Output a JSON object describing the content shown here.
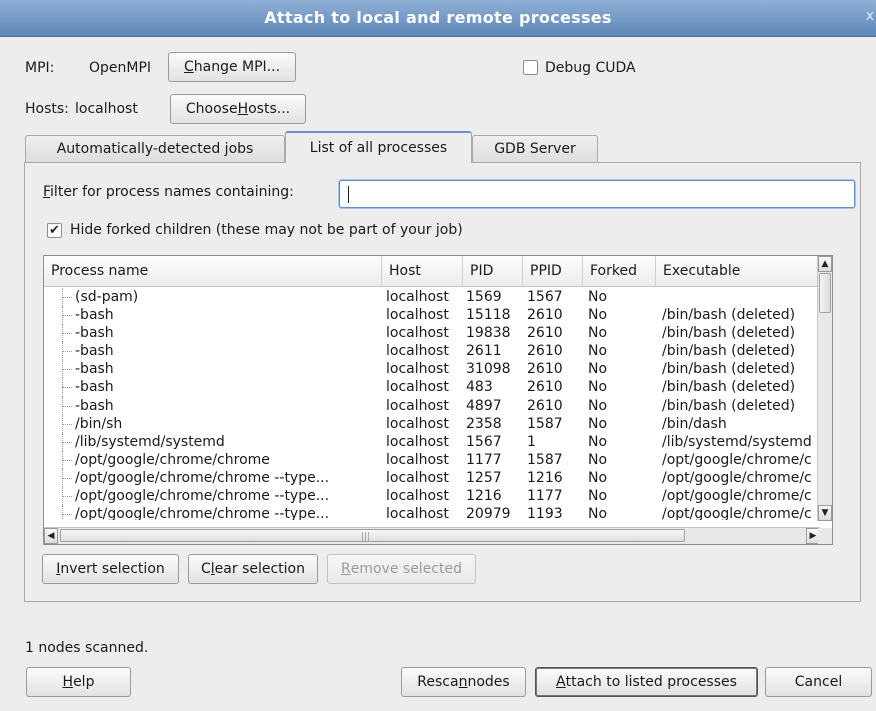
{
  "window": {
    "title": "Attach to local and remote processes",
    "close_glyph": "x"
  },
  "mpi": {
    "label": "MPI:",
    "value": "OpenMPI",
    "change_button": "Change MPI...",
    "change_mnemonic": "C"
  },
  "hosts": {
    "label": "Hosts:",
    "value": "localhost",
    "choose_button": "Choose Hosts...",
    "choose_mnemonic": "H"
  },
  "debug_cuda": {
    "label": "Debug CUDA",
    "checked": false
  },
  "tabs": [
    {
      "label": "Automatically-detected jobs",
      "active": false
    },
    {
      "label": "List of all processes",
      "active": true
    },
    {
      "label": "GDB Server",
      "active": false
    }
  ],
  "filter": {
    "label": "Filter for process names containing:",
    "mnemonic": "F",
    "value": ""
  },
  "hide_forked": {
    "label": "Hide forked children (these may not be part of your job)",
    "checked": true,
    "check_glyph": "✔"
  },
  "table": {
    "columns": [
      "Process name",
      "Host",
      "PID",
      "PPID",
      "Forked",
      "Executable"
    ],
    "rows": [
      [
        "(sd-pam)",
        "localhost",
        "1569",
        "1567",
        "No",
        ""
      ],
      [
        "-bash",
        "localhost",
        "15118",
        "2610",
        "No",
        "/bin/bash (deleted)"
      ],
      [
        "-bash",
        "localhost",
        "19838",
        "2610",
        "No",
        "/bin/bash (deleted)"
      ],
      [
        "-bash",
        "localhost",
        "2611",
        "2610",
        "No",
        "/bin/bash (deleted)"
      ],
      [
        "-bash",
        "localhost",
        "31098",
        "2610",
        "No",
        "/bin/bash (deleted)"
      ],
      [
        "-bash",
        "localhost",
        "483",
        "2610",
        "No",
        "/bin/bash (deleted)"
      ],
      [
        "-bash",
        "localhost",
        "4897",
        "2610",
        "No",
        "/bin/bash (deleted)"
      ],
      [
        "/bin/sh",
        "localhost",
        "2358",
        "1587",
        "No",
        "/bin/dash"
      ],
      [
        "/lib/systemd/systemd",
        "localhost",
        "1567",
        "1",
        "No",
        "/lib/systemd/systemd"
      ],
      [
        "/opt/google/chrome/chrome",
        "localhost",
        "1177",
        "1587",
        "No",
        "/opt/google/chrome/c"
      ],
      [
        "/opt/google/chrome/chrome --type...",
        "localhost",
        "1257",
        "1216",
        "No",
        "/opt/google/chrome/c"
      ],
      [
        "/opt/google/chrome/chrome --type...",
        "localhost",
        "1216",
        "1177",
        "No",
        "/opt/google/chrome/c"
      ],
      [
        "/opt/google/chrome/chrome --type...",
        "localhost",
        "20979",
        "1193",
        "No",
        "/opt/google/chrome/c"
      ]
    ]
  },
  "selection_buttons": {
    "invert": "Invert selection",
    "invert_mnemonic": "I",
    "clear": "Clear selection",
    "clear_mnemonic": "l",
    "remove": "Remove selected",
    "remove_mnemonic": "R"
  },
  "status": "1 nodes scanned.",
  "footer": {
    "help": "Help",
    "help_mnemonic": "H",
    "rescan": "Rescan nodes",
    "rescan_mnemonic": "n",
    "attach": "Attach to listed processes",
    "attach_mnemonic": "A",
    "cancel": "Cancel"
  },
  "icons": {
    "scroll_up": "▲",
    "scroll_down": "▼",
    "scroll_left": "◀",
    "scroll_right": "▶",
    "grip": "|||"
  }
}
